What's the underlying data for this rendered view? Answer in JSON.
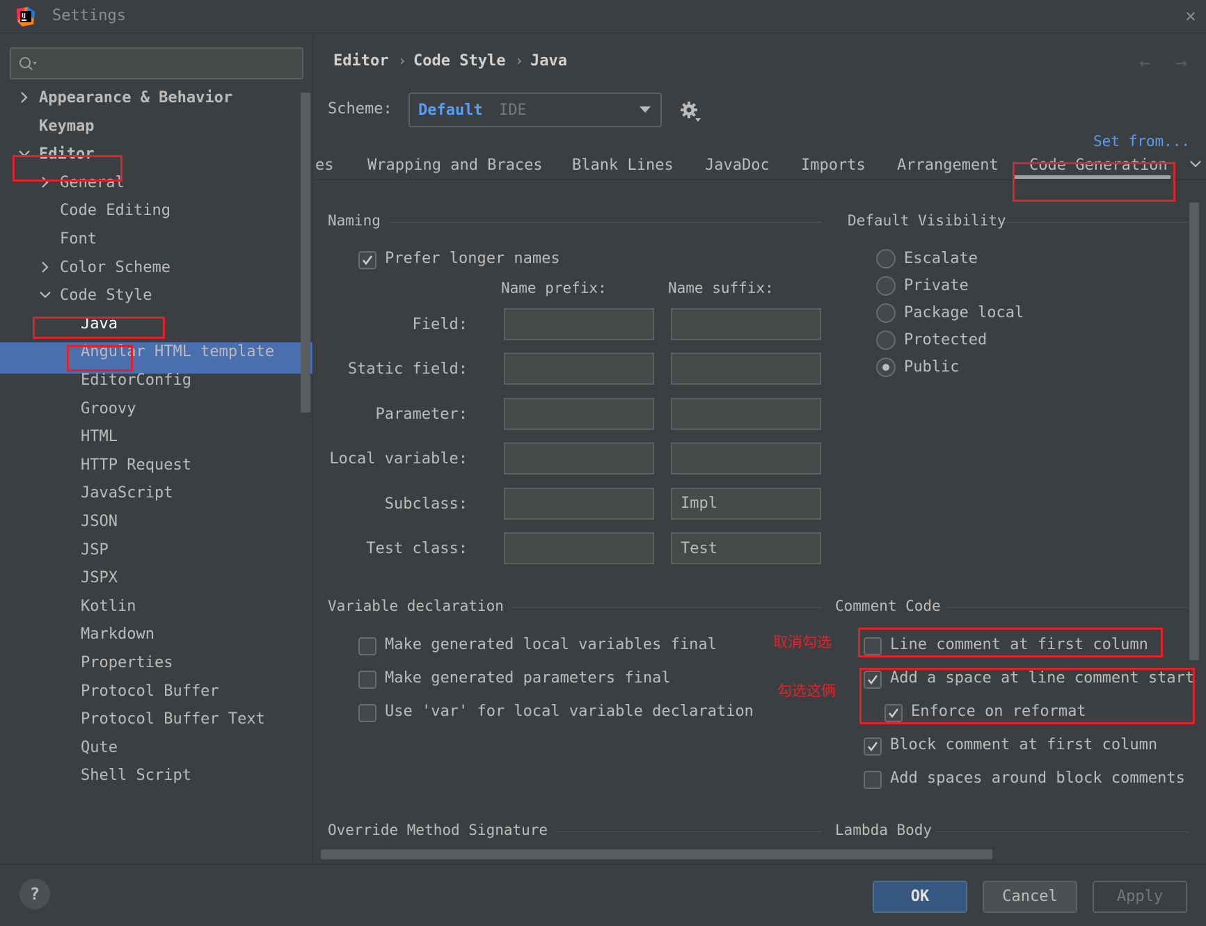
{
  "window": {
    "title": "Settings",
    "close_glyph": "✕"
  },
  "search": {
    "placeholder": ""
  },
  "tree": [
    {
      "label": "Appearance & Behavior",
      "bold": true,
      "chevron": "right"
    },
    {
      "label": "Keymap",
      "bold": true,
      "chevron": "none"
    },
    {
      "label": "Editor",
      "bold": true,
      "chevron": "down"
    },
    {
      "label": "General",
      "bold": false,
      "chevron": "right"
    },
    {
      "label": "Code Editing",
      "bold": false,
      "chevron": "none"
    },
    {
      "label": "Font",
      "bold": false,
      "chevron": "none"
    },
    {
      "label": "Color Scheme",
      "bold": false,
      "chevron": "right"
    },
    {
      "label": "Code Style",
      "bold": false,
      "chevron": "down"
    },
    {
      "label": "Java",
      "bold": false,
      "chevron": "none",
      "selected": true
    },
    {
      "label": "Angular HTML template",
      "bold": false,
      "chevron": "none"
    },
    {
      "label": "EditorConfig",
      "bold": false,
      "chevron": "none"
    },
    {
      "label": "Groovy",
      "bold": false,
      "chevron": "none"
    },
    {
      "label": "HTML",
      "bold": false,
      "chevron": "none"
    },
    {
      "label": "HTTP Request",
      "bold": false,
      "chevron": "none"
    },
    {
      "label": "JavaScript",
      "bold": false,
      "chevron": "none"
    },
    {
      "label": "JSON",
      "bold": false,
      "chevron": "none"
    },
    {
      "label": "JSP",
      "bold": false,
      "chevron": "none"
    },
    {
      "label": "JSPX",
      "bold": false,
      "chevron": "none"
    },
    {
      "label": "Kotlin",
      "bold": false,
      "chevron": "none"
    },
    {
      "label": "Markdown",
      "bold": false,
      "chevron": "none"
    },
    {
      "label": "Properties",
      "bold": false,
      "chevron": "none"
    },
    {
      "label": "Protocol Buffer",
      "bold": false,
      "chevron": "none"
    },
    {
      "label": "Protocol Buffer Text",
      "bold": false,
      "chevron": "none"
    },
    {
      "label": "Qute",
      "bold": false,
      "chevron": "none"
    },
    {
      "label": "Shell Script",
      "bold": false,
      "chevron": "none"
    }
  ],
  "breadcrumb": {
    "items": [
      "Editor",
      "Code Style",
      "Java"
    ],
    "separator": "›"
  },
  "nav": {
    "back": "←",
    "forward": "→"
  },
  "scheme": {
    "label": "Scheme:",
    "value": "Default",
    "sub": "IDE"
  },
  "set_from": "Set from...",
  "tabs": [
    {
      "label": "es"
    },
    {
      "label": "Wrapping and Braces"
    },
    {
      "label": "Blank Lines"
    },
    {
      "label": "JavaDoc"
    },
    {
      "label": "Imports"
    },
    {
      "label": "Arrangement"
    },
    {
      "label": "Code Generation",
      "active": true
    }
  ],
  "naming": {
    "title": "Naming",
    "prefer_longer": {
      "label": "Prefer longer names",
      "checked": true
    },
    "prefix_header": "Name prefix:",
    "suffix_header": "Name suffix:",
    "rows": [
      {
        "label": "Field:",
        "prefix": "",
        "suffix": ""
      },
      {
        "label": "Static field:",
        "prefix": "",
        "suffix": ""
      },
      {
        "label": "Parameter:",
        "prefix": "",
        "suffix": ""
      },
      {
        "label": "Local variable:",
        "prefix": "",
        "suffix": ""
      },
      {
        "label": "Subclass:",
        "prefix": "",
        "suffix": "Impl"
      },
      {
        "label": "Test class:",
        "prefix": "",
        "suffix": "Test"
      }
    ]
  },
  "visibility": {
    "title": "Default Visibility",
    "options": [
      {
        "label": "Escalate",
        "selected": false
      },
      {
        "label": "Private",
        "selected": false
      },
      {
        "label": "Package local",
        "selected": false
      },
      {
        "label": "Protected",
        "selected": false
      },
      {
        "label": "Public",
        "selected": true
      }
    ]
  },
  "variable_decl": {
    "title": "Variable declaration",
    "options": [
      {
        "label": "Make generated local variables final",
        "checked": false
      },
      {
        "label": "Make generated parameters final",
        "checked": false
      },
      {
        "label": "Use 'var' for local variable declaration",
        "checked": false
      }
    ]
  },
  "comment_code": {
    "title": "Comment Code",
    "options": [
      {
        "label": "Line comment at first column",
        "checked": false
      },
      {
        "label": "Add a space at line comment start",
        "checked": true
      },
      {
        "label": "Enforce on reformat",
        "checked": true
      },
      {
        "label": "Block comment at first column",
        "checked": true
      },
      {
        "label": "Add spaces around block comments",
        "checked": false
      }
    ]
  },
  "annotations": {
    "uncheck": "取消勾选",
    "check_these": "勾选这俩"
  },
  "override_title": "Override Method Signature",
  "lambda_title": "Lambda Body",
  "buttons": {
    "help": "?",
    "ok": "OK",
    "cancel": "Cancel",
    "apply": "Apply"
  },
  "colors": {
    "accent": "#589df6",
    "selection": "#4b6eaf",
    "annotation": "#e0232a",
    "ok_button": "#365880"
  }
}
